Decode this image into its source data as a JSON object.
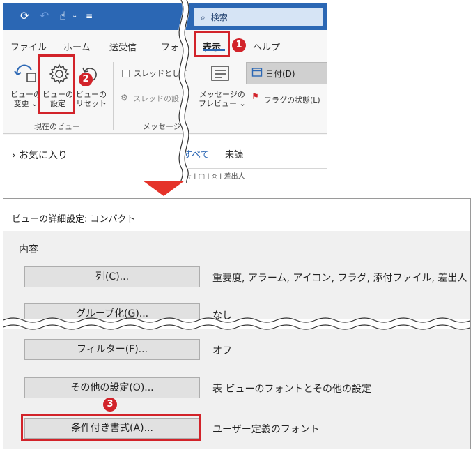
{
  "ribbon": {
    "search_label": "検索",
    "tabs": {
      "file": "ファイル",
      "home": "ホーム",
      "send_receive": "送受信",
      "folder_partial": "フォ",
      "view": "表示",
      "help_partial": "ヘルプ"
    },
    "buttons": {
      "change_view_line1": "ビューの",
      "change_view_line2": "変更",
      "view_settings_line1": "ビューの",
      "view_settings_line2": "設定",
      "reset_view_line1": "ビューの",
      "reset_view_line2": "リセット",
      "show_thread": "スレッドとして",
      "thread_settings": "スレッドの設",
      "message_preview_line1": "メッセージの",
      "message_preview_line2": "プレビュー",
      "sort_date": "日付(D)",
      "flag_status": "フラグの状態(L)"
    },
    "groups": {
      "current_view": "現在のビュー",
      "messages_partial": "メッセージ"
    },
    "nav": {
      "favorites": "お気に入り",
      "filter_all": "すべて",
      "filter_unread": "未読",
      "column_from": "差出人"
    }
  },
  "dialog": {
    "title": "ビューの詳細設定: コンパクト",
    "group_label": "内容",
    "rows": [
      {
        "button": "列(C)...",
        "desc": "重要度, アラーム, アイコン, フラグ, 添付ファイル, 差出人"
      },
      {
        "button": "グループ化(G)...",
        "desc": "なし"
      },
      {
        "button": "フィルター(F)...",
        "desc": "オフ"
      },
      {
        "button": "その他の設定(O)...",
        "desc": "表 ビューのフォントとその他の設定"
      },
      {
        "button": "条件付き書式(A)...",
        "desc": "ユーザー定義のフォント"
      }
    ]
  },
  "callouts": {
    "step1": "1",
    "step2": "2",
    "step3": "3",
    "color": "#d2232a"
  },
  "colors": {
    "titlebar": "#2b67b4",
    "arrow": "#e5332a"
  }
}
